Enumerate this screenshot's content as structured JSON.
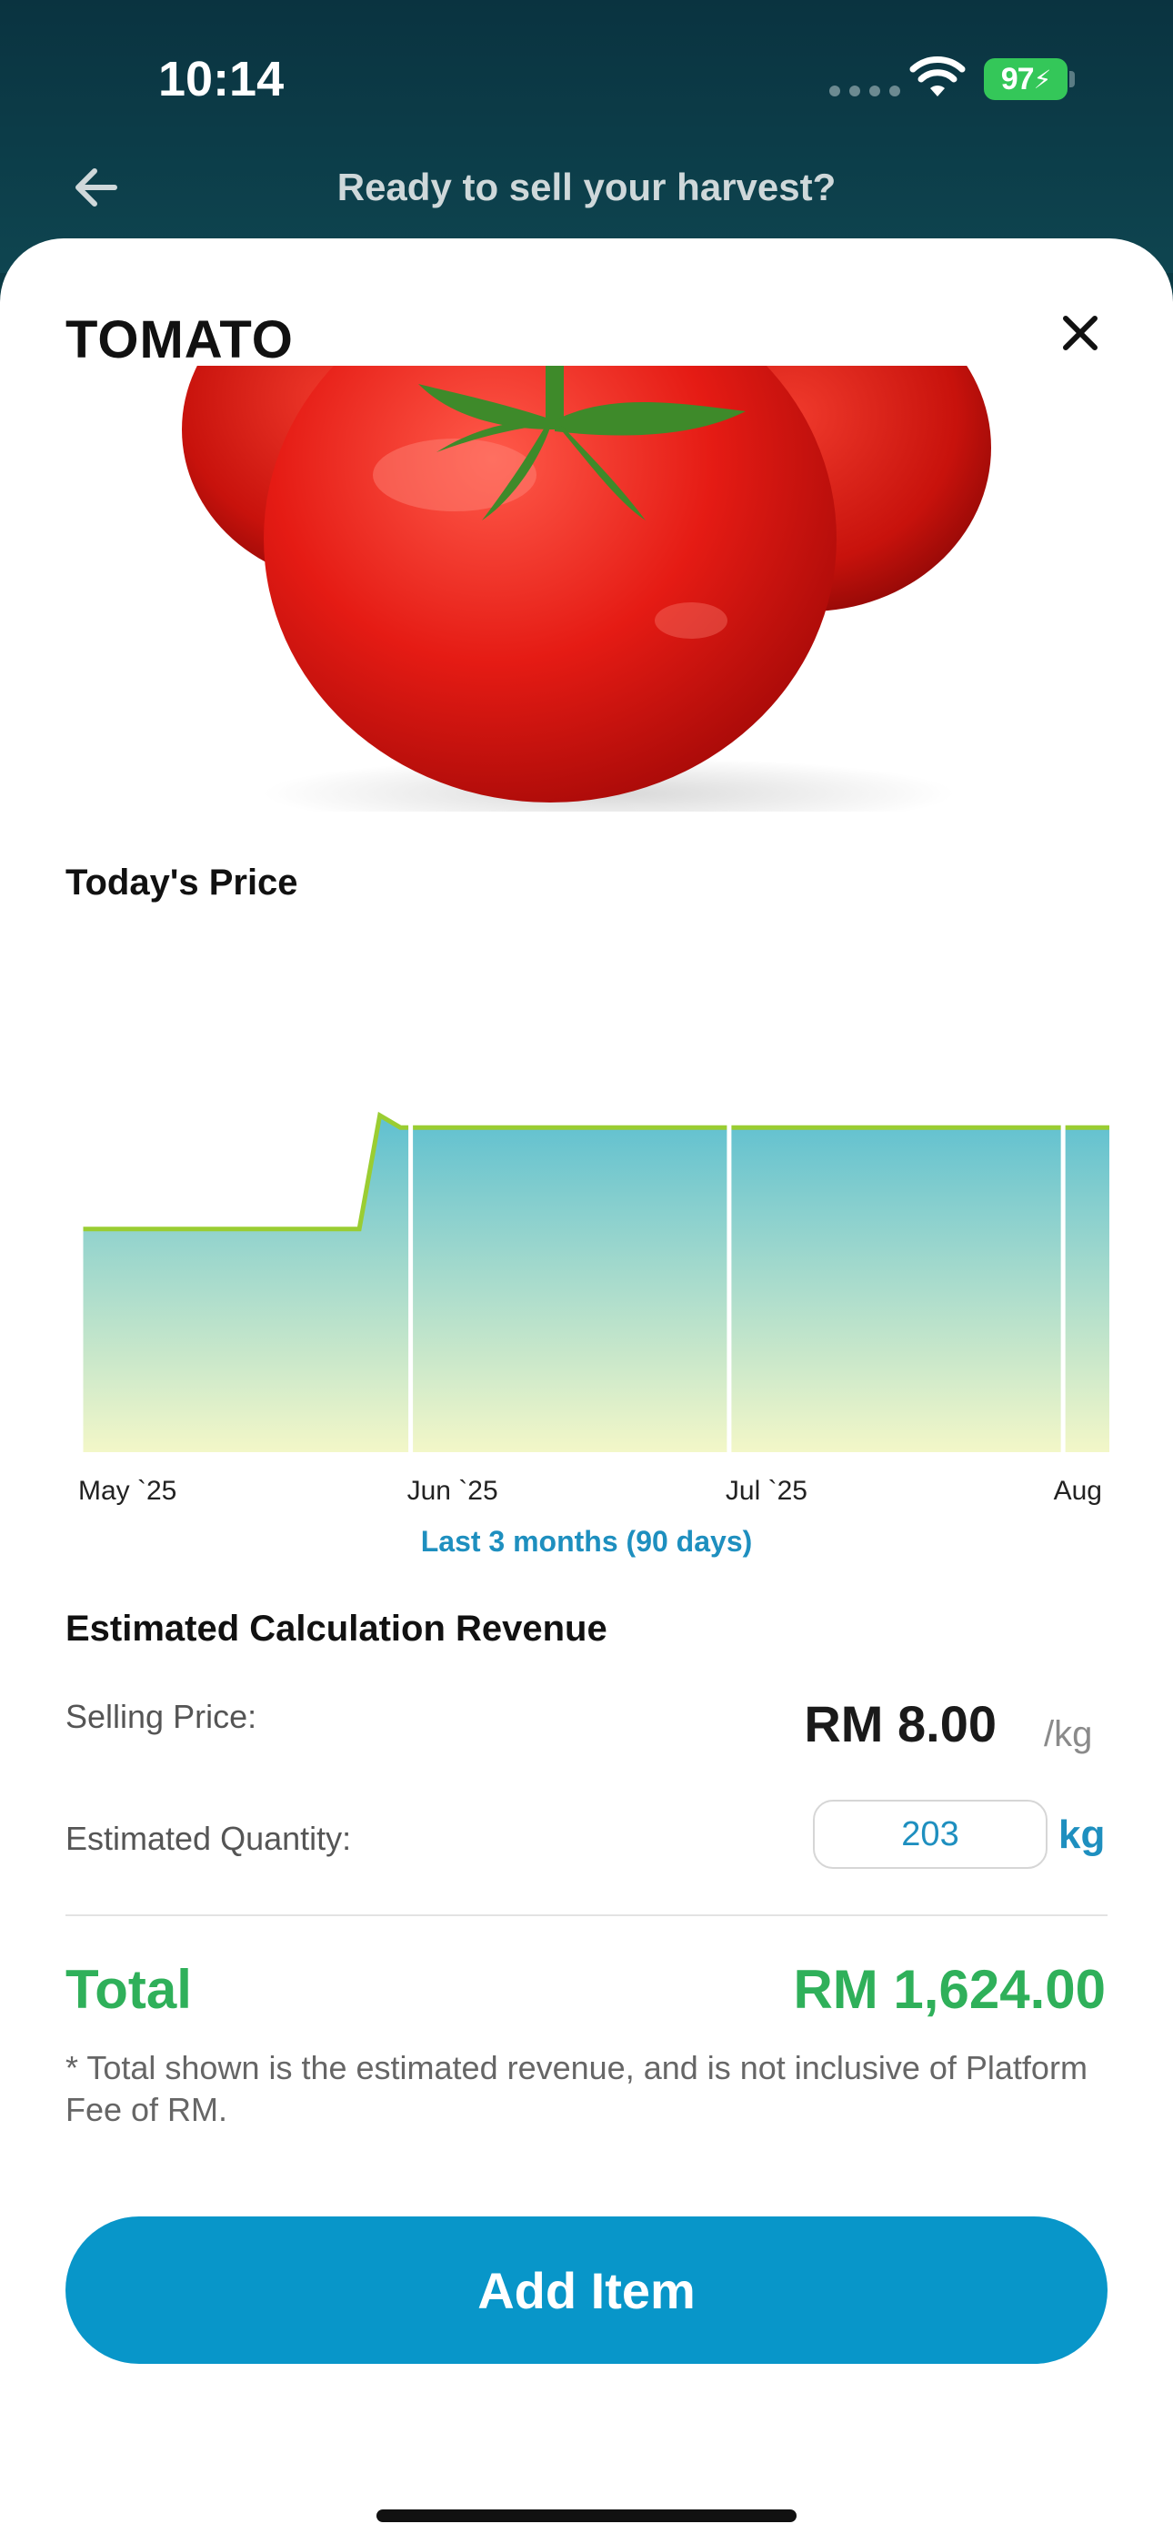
{
  "status_bar": {
    "time": "10:14",
    "battery": "97",
    "icons": [
      "signal-icon",
      "wifi-icon",
      "battery-icon"
    ]
  },
  "header": {
    "title": "Ready to sell your harvest?",
    "back_icon": "arrow-left-icon"
  },
  "product": {
    "name": "TOMATO",
    "close_icon": "close-icon",
    "image": "tomato-photo"
  },
  "price_chart": {
    "section_title": "Today's Price",
    "range_label": "Last 3 months (90 days)"
  },
  "chart_data": {
    "type": "area",
    "x": [
      "May `25",
      "Jun `25",
      "Jul `25",
      "Aug"
    ],
    "series": [
      {
        "points": [
          {
            "t": 0.0,
            "v": 5.5
          },
          {
            "t": 0.27,
            "v": 5.5
          },
          {
            "t": 0.29,
            "v": 8.3
          },
          {
            "t": 0.31,
            "v": 8.0
          },
          {
            "t": 1.0,
            "v": 8.0
          }
        ]
      }
    ],
    "ylim": [
      0,
      10
    ],
    "grid": "vertical",
    "colors": {
      "top": "#5fc0d0",
      "bottom": "#f3f7c8",
      "line_low": "#9acd32",
      "line_high": "#5bb8c9"
    }
  },
  "calculation": {
    "section_title": "Estimated Calculation Revenue",
    "selling_price_label": "Selling Price:",
    "selling_price_value": "RM 8.00",
    "selling_price_unit": "/kg",
    "quantity_label": "Estimated Quantity:",
    "quantity_value": "203",
    "quantity_unit": "kg",
    "total_label": "Total",
    "total_value": "RM 1,624.00",
    "footnote": "* Total shown is the estimated revenue, and is not inclusive of Platform Fee of RM."
  },
  "actions": {
    "add_item_label": "Add Item"
  },
  "colors": {
    "accent": "#0896c9",
    "total_green": "#2fb05a",
    "header_bg": "#0a3340"
  }
}
